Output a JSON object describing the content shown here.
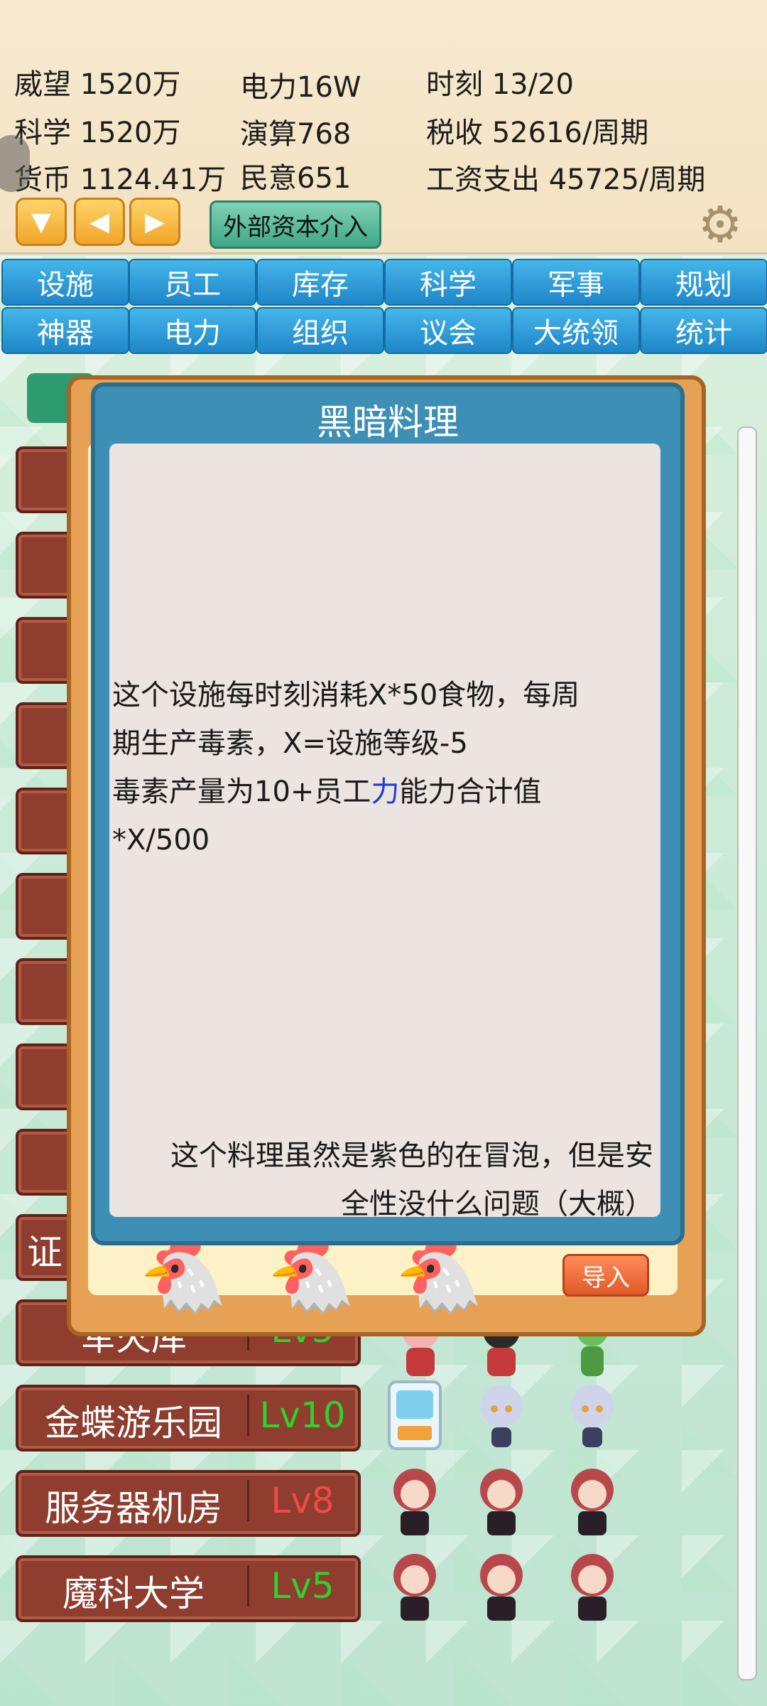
{
  "stats": {
    "prestige": "威望 1520万",
    "science": "科学 1520万",
    "currency": "货币 1124.41万",
    "power": "电力16W",
    "compute": "演算768",
    "opinion": "民意651",
    "time": "时刻 13/20",
    "tax": "税收 52616/周期",
    "wages": "工资支出 45725/周期"
  },
  "controls": {
    "down_glyph": "▼",
    "left_glyph": "◀",
    "right_glyph": "▶",
    "external_capital": "外部资本介入",
    "settings_icon": "gear-icon"
  },
  "tabs_row1": [
    "设施",
    "员工",
    "库存",
    "科学",
    "军事",
    "规划"
  ],
  "tabs_row2": [
    "神器",
    "电力",
    "组织",
    "议会",
    "大统领",
    "统计"
  ],
  "facilities": [
    {
      "name": "证",
      "level": ""
    },
    {
      "name": "军火库",
      "level": "Lv5"
    },
    {
      "name": "金蝶游乐园",
      "level": "Lv10",
      "level_color": "#2ed12e"
    },
    {
      "name": "服务器机房",
      "level": "Lv8",
      "level_color": "#ef4a4a"
    },
    {
      "name": "魔科大学",
      "level": "Lv5",
      "level_color": "#2ed12e"
    }
  ],
  "panel": {
    "import_label": "导入"
  },
  "dialog": {
    "title": "黑暗料理",
    "desc_line1": "这个设施每时刻消耗X*50食物，每周",
    "desc_line2": "期生产毒素，X=设施等级-5",
    "desc_line3_pre": "毒素产量为10+员工",
    "desc_line3_hl": "力",
    "desc_line3_post": "能力合计值",
    "desc_line4": "*X/500",
    "flavor_line1": "这个料理虽然是紫色的在冒泡，但是安",
    "flavor_line2": "全性没什么问题（大概）"
  }
}
